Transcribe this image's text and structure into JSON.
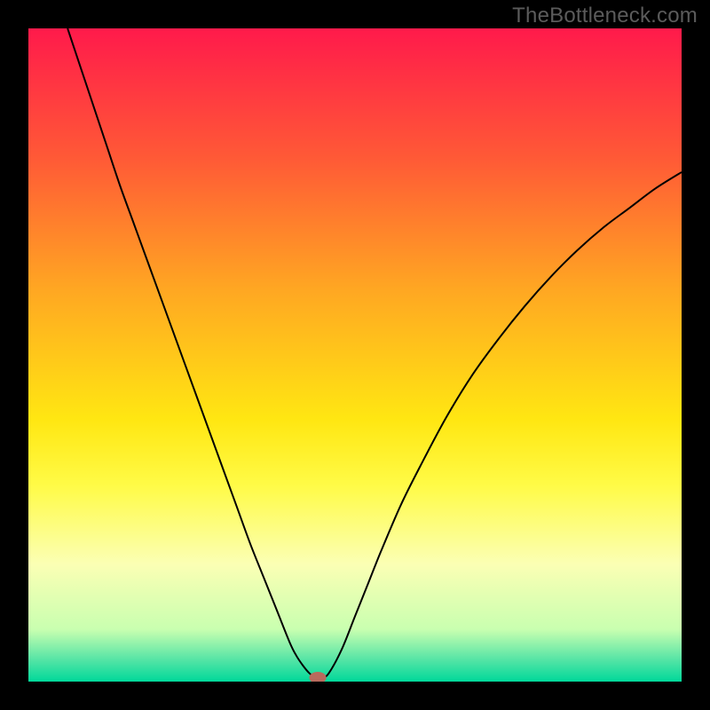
{
  "watermark": "TheBottleneck.com",
  "chart_data": {
    "type": "line",
    "title": "",
    "xlabel": "",
    "ylabel": "",
    "xlim": [
      0,
      100
    ],
    "ylim": [
      0,
      100
    ],
    "grid": false,
    "gradient_stops": [
      {
        "offset": 0.0,
        "color": "#ff1a4b"
      },
      {
        "offset": 0.2,
        "color": "#ff5a36"
      },
      {
        "offset": 0.4,
        "color": "#ffa722"
      },
      {
        "offset": 0.6,
        "color": "#ffe712"
      },
      {
        "offset": 0.7,
        "color": "#fffb47"
      },
      {
        "offset": 0.82,
        "color": "#fbffb4"
      },
      {
        "offset": 0.92,
        "color": "#c9ffb0"
      },
      {
        "offset": 0.965,
        "color": "#59e5a6"
      },
      {
        "offset": 1.0,
        "color": "#00d89a"
      }
    ],
    "series": [
      {
        "name": "curve",
        "color": "#000000",
        "stroke_width": 2,
        "x": [
          6,
          8,
          10,
          12,
          14,
          16,
          18,
          20,
          22,
          24,
          26,
          28,
          30,
          32,
          34,
          36,
          38,
          40,
          41,
          42,
          43,
          44,
          45,
          46,
          48,
          50,
          52,
          54,
          57,
          60,
          64,
          68,
          72,
          76,
          80,
          84,
          88,
          92,
          96,
          100
        ],
        "y": [
          100,
          94,
          88,
          82,
          76,
          70.5,
          65,
          59.5,
          54,
          48.5,
          43,
          37.5,
          32,
          26.5,
          21,
          16,
          11,
          6,
          4,
          2.5,
          1.3,
          0.6,
          0.6,
          1.3,
          5,
          10,
          15,
          20,
          27,
          33,
          40.5,
          47,
          52.5,
          57.5,
          62,
          66,
          69.5,
          72.5,
          75.5,
          78
        ]
      }
    ],
    "marker": {
      "x": 44.3,
      "y": 0.6,
      "rx": 1.3,
      "ry": 0.9,
      "color": "#b86a5d"
    }
  }
}
